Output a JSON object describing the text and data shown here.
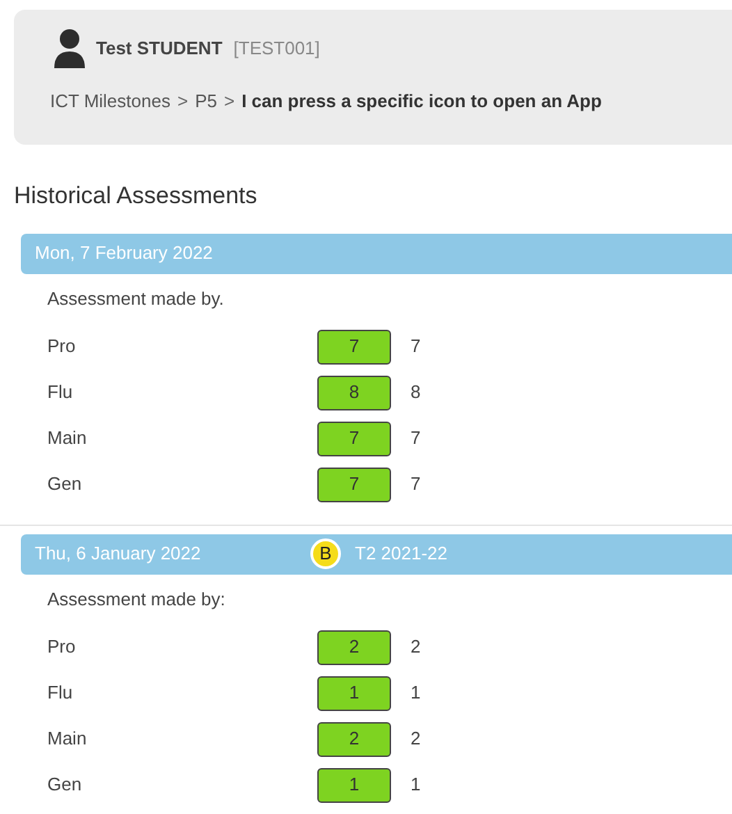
{
  "student": {
    "name": "Test STUDENT",
    "code": "[TEST001]"
  },
  "breadcrumb": {
    "items": [
      "ICT Milestones",
      "P5"
    ],
    "separator": ">",
    "current": "I can press a specific icon to open an App"
  },
  "heading": "Historical Assessments",
  "assessments": [
    {
      "date": "Mon, 7 February 2022",
      "made_by": "Assessment made by.",
      "rows": [
        {
          "label": "Pro",
          "score": "7",
          "value": "7"
        },
        {
          "label": "Flu",
          "score": "8",
          "value": "8"
        },
        {
          "label": "Main",
          "score": "7",
          "value": "7"
        },
        {
          "label": "Gen",
          "score": "7",
          "value": "7"
        }
      ]
    },
    {
      "date": "Thu, 6 January 2022",
      "badge": "B",
      "term": "T2 2021-22",
      "made_by": "Assessment made by:",
      "rows": [
        {
          "label": "Pro",
          "score": "2",
          "value": "2"
        },
        {
          "label": "Flu",
          "score": "1",
          "value": "1"
        },
        {
          "label": "Main",
          "score": "2",
          "value": "2"
        },
        {
          "label": "Gen",
          "score": "1",
          "value": "1"
        }
      ]
    }
  ]
}
